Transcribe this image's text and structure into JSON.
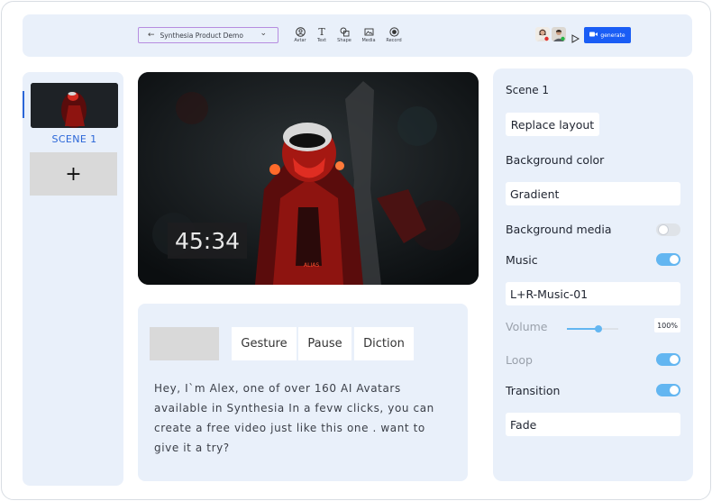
{
  "toolbar": {
    "project_title": "Synthesia Product Demo",
    "tools": [
      {
        "label": "Avtar",
        "icon": "avatar-icon"
      },
      {
        "label": "Text",
        "icon": "text-icon"
      },
      {
        "label": "Shape",
        "icon": "shape-icon"
      },
      {
        "label": "Media",
        "icon": "media-icon"
      },
      {
        "label": "Record",
        "icon": "record-icon"
      }
    ],
    "generate_label": "generate",
    "accent": "#1a5df5"
  },
  "scenes": {
    "items": [
      {
        "label": "SCENE 1"
      }
    ],
    "add_label": "+"
  },
  "preview": {
    "timer": "45:34"
  },
  "script": {
    "chips": [
      "Gesture",
      "Pause",
      "Diction"
    ],
    "text": "Hey, I`m Alex, one of over 160 AI Avatars available in Synthesia In a fevw clicks, you can create a free video just like this one . want to give it a try?"
  },
  "settings": {
    "scene_title": "Scene 1",
    "replace_layout_label": "Replace layout",
    "background_color_label": "Background color",
    "background_color_value": "Gradient",
    "background_media_label": "Background media",
    "background_media_on": false,
    "music_label": "Music",
    "music_on": true,
    "music_value": "L+R-Music-01",
    "volume_label": "Volume",
    "volume_value": "100%",
    "volume_level": 0.62,
    "loop_label": "Loop",
    "loop_on": true,
    "transition_label": "Transition",
    "transition_on": true,
    "transition_value": "Fade",
    "toggle_color": "#63b6f1"
  }
}
